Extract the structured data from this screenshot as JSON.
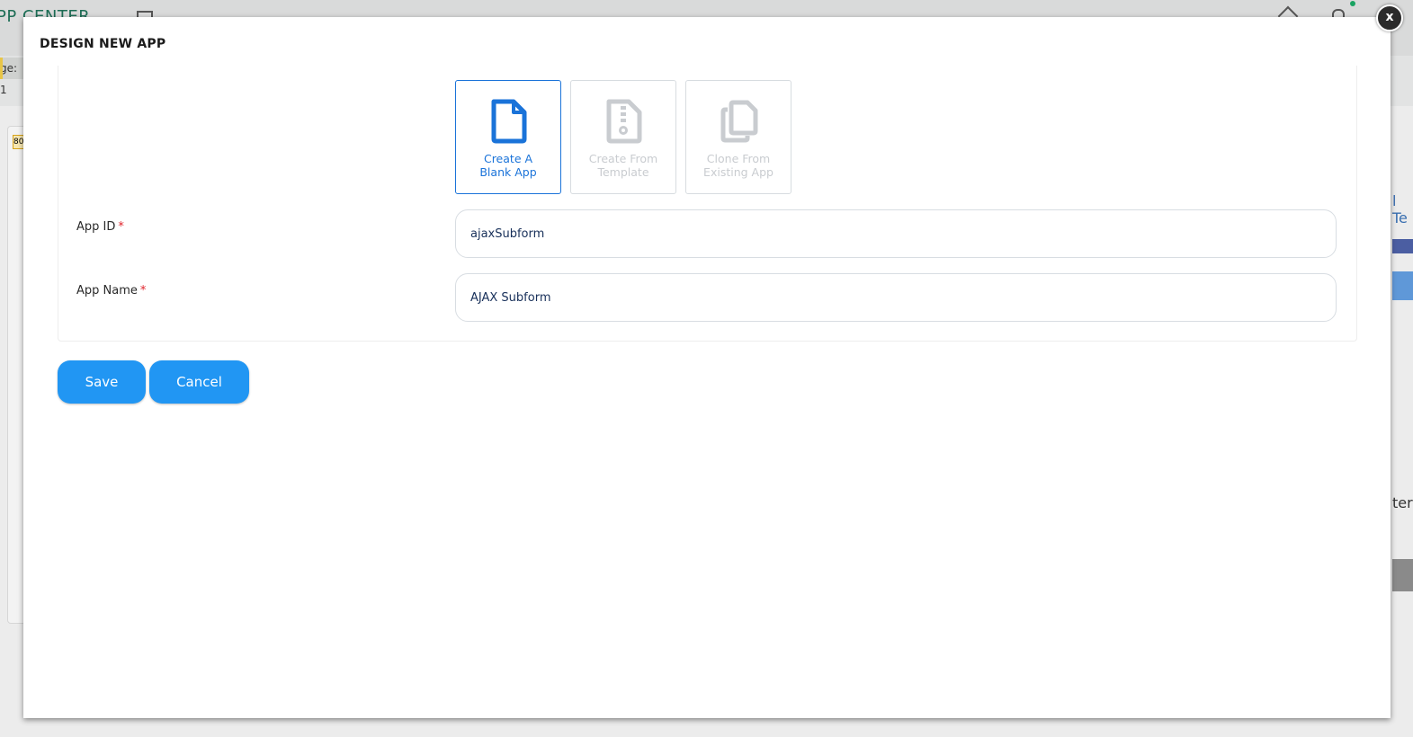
{
  "background": {
    "app_title": "PP CENTER",
    "strip_text": "ge: 1",
    "badge_text": "80",
    "right_text_1": "l Te",
    "right_text_2": "ter"
  },
  "modal": {
    "title": "DESIGN NEW APP",
    "close_label": "x",
    "options": [
      {
        "line1": "Create A",
        "line2": "Blank App",
        "icon": "blank-document-icon",
        "active": true
      },
      {
        "line1": "Create From",
        "line2": "Template",
        "icon": "zip-file-icon",
        "active": false
      },
      {
        "line1": "Clone From",
        "line2": "Existing App",
        "icon": "copy-icon",
        "active": false
      }
    ],
    "fields": {
      "app_id": {
        "label": "App ID",
        "required": "*",
        "value": "ajaxSubform"
      },
      "app_name": {
        "label": "App Name",
        "required": "*",
        "value": "AJAX Subform"
      }
    },
    "buttons": {
      "save": "Save",
      "cancel": "Cancel"
    }
  },
  "colors": {
    "accent": "#2196f3",
    "active_option": "#1a73d9",
    "inactive_option": "#c9ccd0",
    "required": "#e0242c"
  }
}
